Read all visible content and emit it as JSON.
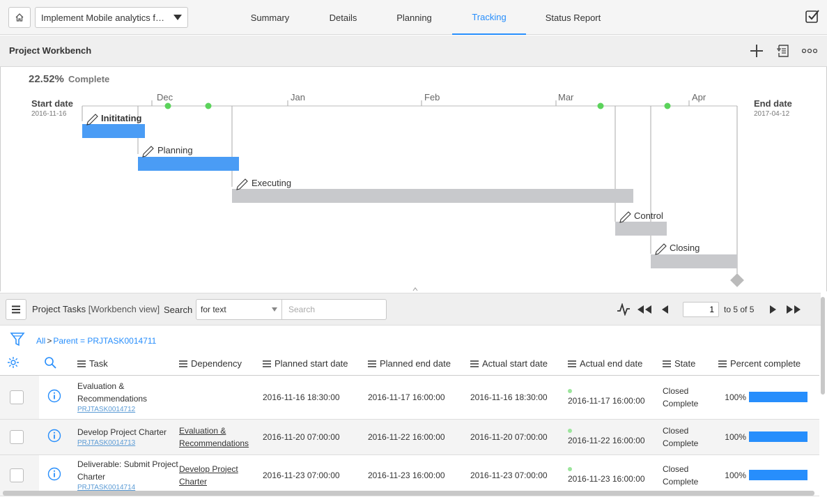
{
  "header": {
    "project_name": "Implement Mobile analytics for ...",
    "tabs": [
      {
        "label": "Summary",
        "active": false
      },
      {
        "label": "Details",
        "active": false
      },
      {
        "label": "Planning",
        "active": false
      },
      {
        "label": "Tracking",
        "active": true
      },
      {
        "label": "Status Report",
        "active": false
      }
    ]
  },
  "workbench": {
    "title": "Project Workbench",
    "actions": [
      "plus-icon",
      "list-icon",
      "more-icon"
    ]
  },
  "gantt": {
    "complete_pct": "22.52%",
    "complete_label": "Complete",
    "start_label": "Start date",
    "start_value": "2016-11-16",
    "end_label": "End date",
    "end_value": "2017-04-12",
    "months": [
      "Dec",
      "Jan",
      "Feb",
      "Mar",
      "Apr"
    ],
    "phases": [
      {
        "name": "Inititating",
        "bold": true,
        "status": "complete"
      },
      {
        "name": "Planning",
        "bold": false,
        "status": "complete"
      },
      {
        "name": "Executing",
        "bold": false,
        "status": "pending"
      },
      {
        "name": "Control",
        "bold": false,
        "status": "pending"
      },
      {
        "name": "Closing",
        "bold": false,
        "status": "pending"
      }
    ],
    "colors": {
      "complete": "#4a9cf5",
      "pending": "#c8c9cc",
      "milestone": "#5bd35b"
    }
  },
  "tasks": {
    "title": "Project Tasks",
    "subtitle": "[Workbench view]",
    "search_label": "Search",
    "search_field": "for text",
    "search_placeholder": "Search",
    "page_value": "1",
    "page_text": "to 5 of 5",
    "breadcrumb": {
      "all": "All",
      "sep": ">",
      "parent": "Parent = PRJTASK0014711"
    },
    "columns": [
      "Task",
      "Dependency",
      "Planned start date",
      "Planned end date",
      "Actual start date",
      "Actual end date",
      "State",
      "Percent complete"
    ],
    "rows": [
      {
        "task": "Evaluation & Recommendations",
        "number": "PRJTASK0014712",
        "dependency": "",
        "planned_start": "2016-11-16 18:30:00",
        "planned_end": "2016-11-17 16:00:00",
        "actual_start": "2016-11-16 18:30:00",
        "actual_end": "2016-11-17 16:00:00",
        "state": "Closed Complete",
        "percent": "100%"
      },
      {
        "task": "Develop Project Charter",
        "number": "PRJTASK0014713",
        "dependency": "Evaluation & Recommendations",
        "planned_start": "2016-11-20 07:00:00",
        "planned_end": "2016-11-22 16:00:00",
        "actual_start": "2016-11-20 07:00:00",
        "actual_end": "2016-11-22 16:00:00",
        "state": "Closed Complete",
        "percent": "100%"
      },
      {
        "task": "Deliverable: Submit Project Charter",
        "number": "PRJTASK0014714",
        "dependency": "Develop Project Charter",
        "planned_start": "2016-11-23 07:00:00",
        "planned_end": "2016-11-23 16:00:00",
        "actual_start": "2016-11-23 07:00:00",
        "actual_end": "2016-11-23 16:00:00",
        "state": "Closed Complete",
        "percent": "100%"
      }
    ],
    "accent": "#278efc"
  }
}
